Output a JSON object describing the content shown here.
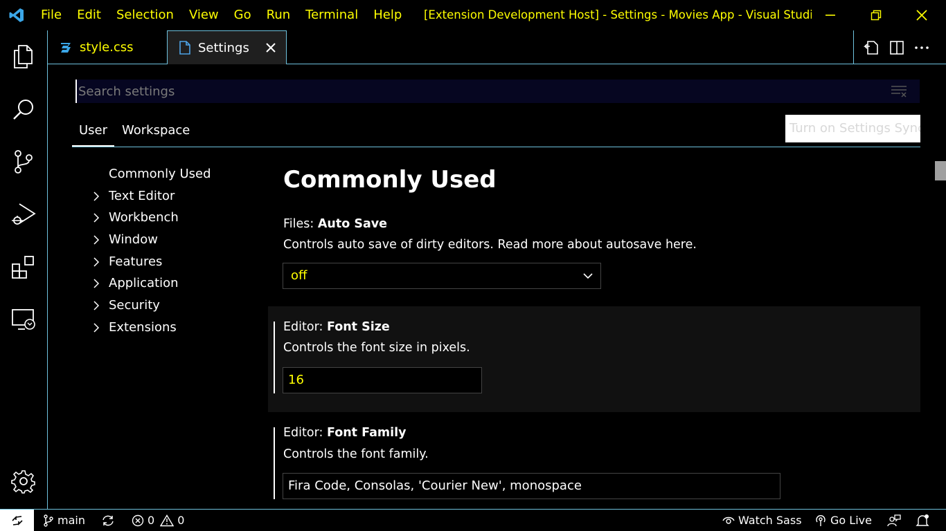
{
  "window": {
    "title": "[Extension Development Host] - Settings - Movies App - Visual Studio ...",
    "accent_color": "#ffff00",
    "border_color": "#6fc3df"
  },
  "menu": [
    "File",
    "Edit",
    "Selection",
    "View",
    "Go",
    "Run",
    "Terminal",
    "Help"
  ],
  "activity_icons": [
    "files-icon",
    "search-icon",
    "source-control-icon",
    "run-debug-icon",
    "extensions-icon",
    "remote-explorer-icon",
    "settings-gear-icon"
  ],
  "tabs": [
    {
      "label": "style.css",
      "icon": "css-icon"
    },
    {
      "label": "Settings",
      "icon": "file-icon",
      "active": true
    }
  ],
  "settings": {
    "search_placeholder": "Search settings",
    "scope_tabs": {
      "user": "User",
      "workspace": "Workspace"
    },
    "sync_button": "Turn on Settings Sync",
    "toc": [
      "Commonly Used",
      "Text Editor",
      "Workbench",
      "Window",
      "Features",
      "Application",
      "Security",
      "Extensions"
    ],
    "section_title": "Commonly Used",
    "items": [
      {
        "category": "Files: ",
        "key": "Auto Save",
        "description": "Controls auto save of dirty editors. Read more about autosave ",
        "link": "here",
        "description_end": ".",
        "value": "off"
      },
      {
        "category": "Editor: ",
        "key": "Font Size",
        "description": "Controls the font size in pixels.",
        "value": "16"
      },
      {
        "category": "Editor: ",
        "key": "Font Family",
        "description": "Controls the font family.",
        "value": "Fira Code, Consolas, 'Courier New', monospace"
      }
    ]
  },
  "statusbar": {
    "branch": "main",
    "errors": "0",
    "warnings": "0",
    "watch_sass": "Watch Sass",
    "go_live": "Go Live"
  }
}
